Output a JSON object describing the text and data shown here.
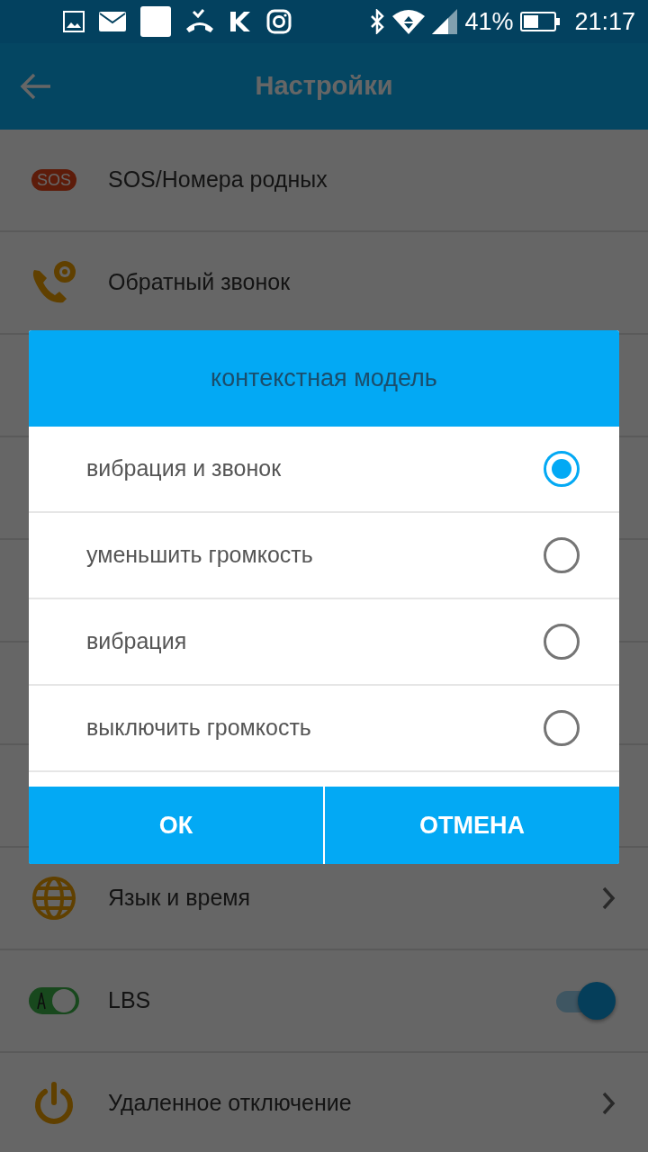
{
  "status_bar": {
    "battery": "41%",
    "time": "21:17"
  },
  "app_bar": {
    "title": "Настройки"
  },
  "settings": [
    {
      "label": "SOS/Номера родных",
      "kind": "plain",
      "badge": "SOS"
    },
    {
      "label": "Обратный звонок",
      "kind": "plain"
    },
    {
      "label": "Язык и время",
      "kind": "link"
    },
    {
      "label": "LBS",
      "kind": "switch",
      "on": true
    },
    {
      "label": "Удаленное отключение",
      "kind": "link"
    }
  ],
  "dialog": {
    "title": "контекстная модель",
    "options": [
      {
        "label": "вибрация и звонок",
        "selected": true
      },
      {
        "label": "уменьшить громкость",
        "selected": false
      },
      {
        "label": "вибрация",
        "selected": false
      },
      {
        "label": "выключить громкость",
        "selected": false
      }
    ],
    "buttons": [
      "ОК",
      "ОТМЕНА"
    ]
  }
}
